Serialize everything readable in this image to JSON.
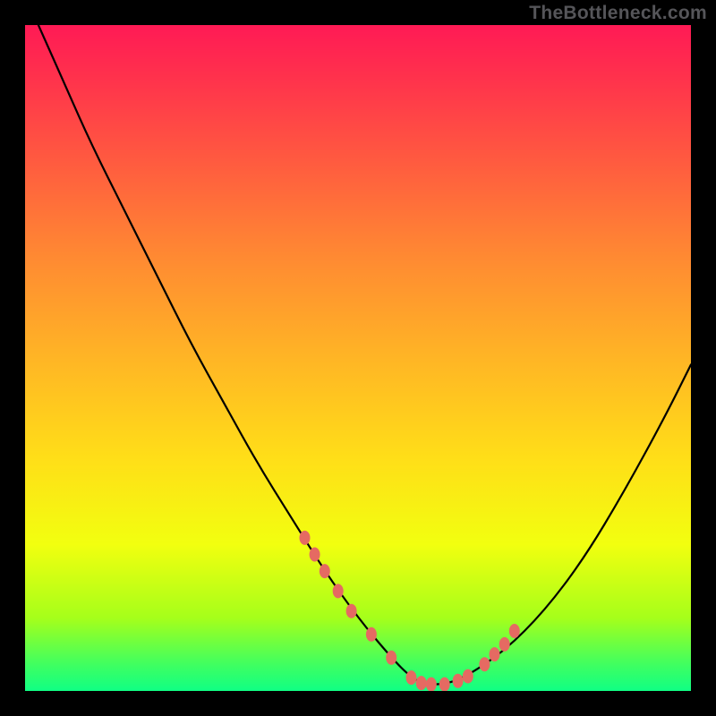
{
  "watermark": "TheBottleneck.com",
  "colors": {
    "frame_border": "#000000",
    "curve_stroke": "#000000",
    "marker_fill": "#e56a62",
    "gradient_stops": [
      "#ff1a55",
      "#ff324c",
      "#ff5940",
      "#ff8a32",
      "#ffb525",
      "#ffde18",
      "#f2ff0f",
      "#a6ff1a",
      "#40ff60",
      "#10ff84"
    ]
  },
  "chart_data": {
    "type": "line",
    "title": "",
    "xlabel": "",
    "ylabel": "",
    "xlim": [
      0,
      100
    ],
    "ylim": [
      0,
      100
    ],
    "series": [
      {
        "name": "bottleneck-curve",
        "x": [
          2,
          6,
          10,
          15,
          20,
          25,
          30,
          35,
          40,
          45,
          50,
          55,
          58,
          60,
          63,
          66,
          72,
          78,
          84,
          90,
          96,
          100
        ],
        "y": [
          100,
          91,
          82,
          72,
          62,
          52,
          43,
          34,
          26,
          18,
          11,
          5,
          2,
          1,
          1,
          2,
          6,
          12,
          20,
          30,
          41,
          49
        ]
      }
    ],
    "markers": {
      "name": "highlight-points",
      "x": [
        42,
        43.5,
        45,
        47,
        49,
        52,
        55,
        58,
        59.5,
        61,
        63,
        65,
        66.5,
        69,
        70.5,
        72,
        73.5
      ],
      "y": [
        23,
        20.5,
        18,
        15,
        12,
        8.5,
        5,
        2,
        1.2,
        1,
        1,
        1.5,
        2.2,
        4,
        5.5,
        7,
        9
      ]
    }
  }
}
